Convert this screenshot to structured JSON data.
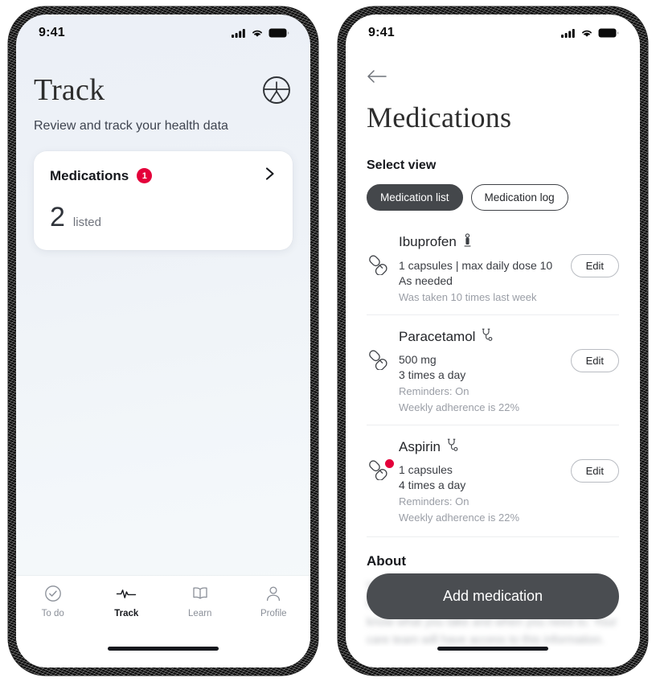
{
  "left": {
    "status": {
      "time": "9:41",
      "signal_icon": "signal-bars-icon",
      "wifi_icon": "wifi-icon",
      "battery_icon": "battery-icon"
    },
    "header": {
      "title": "Track",
      "subtitle": "Review and track your health data",
      "logo_icon": "app-logo-icon"
    },
    "card": {
      "title": "Medications",
      "badge": "1",
      "chevron_icon": "chevron-right-icon",
      "stat_number": "2",
      "stat_label": "listed"
    },
    "tabs": [
      {
        "label": "To do",
        "icon": "check-circle-icon",
        "active": false
      },
      {
        "label": "Track",
        "icon": "pulse-icon",
        "active": true
      },
      {
        "label": "Learn",
        "icon": "book-icon",
        "active": false
      },
      {
        "label": "Profile",
        "icon": "person-icon",
        "active": false
      }
    ]
  },
  "right": {
    "status": {
      "time": "9:41",
      "signal_icon": "signal-bars-icon",
      "wifi_icon": "wifi-icon",
      "battery_icon": "battery-icon"
    },
    "back_icon": "arrow-left-icon",
    "title": "Medications",
    "select_view_label": "Select view",
    "segments": [
      {
        "label": "Medication list",
        "active": true
      },
      {
        "label": "Medication log",
        "active": false
      }
    ],
    "medications": [
      {
        "name": "Ibuprofen",
        "type_icon": "pin-marker-icon",
        "pill_icon": "capsules-icon",
        "alert": false,
        "dose": "1 capsules | max daily dose 10",
        "frequency": "As needed",
        "meta1": "Was taken 10 times last week",
        "meta2": "",
        "edit_label": "Edit"
      },
      {
        "name": "Paracetamol",
        "type_icon": "stethoscope-icon",
        "pill_icon": "capsules-icon",
        "alert": false,
        "dose": "500 mg",
        "frequency": "3 times a day",
        "meta1": "Reminders: On",
        "meta2": "Weekly adherence is 22%",
        "edit_label": "Edit"
      },
      {
        "name": "Aspirin",
        "type_icon": "stethoscope-icon",
        "pill_icon": "capsules-icon",
        "alert": true,
        "dose": "1 capsules",
        "frequency": "4 times a day",
        "meta1": "Reminders: On",
        "meta2": "Weekly adherence is 22%",
        "edit_label": "Edit"
      }
    ],
    "about": {
      "heading": "About",
      "body": "Which values are an important part of your care. Keeping this list up to date helps your care team know what you take and when you need to. Your care team will have access to this information."
    },
    "cta_label": "Add medication"
  },
  "colors": {
    "accent_red": "#e4003a",
    "dark_button": "#4a4d51",
    "text_primary": "#16181d",
    "text_muted": "#9a9ea6"
  }
}
